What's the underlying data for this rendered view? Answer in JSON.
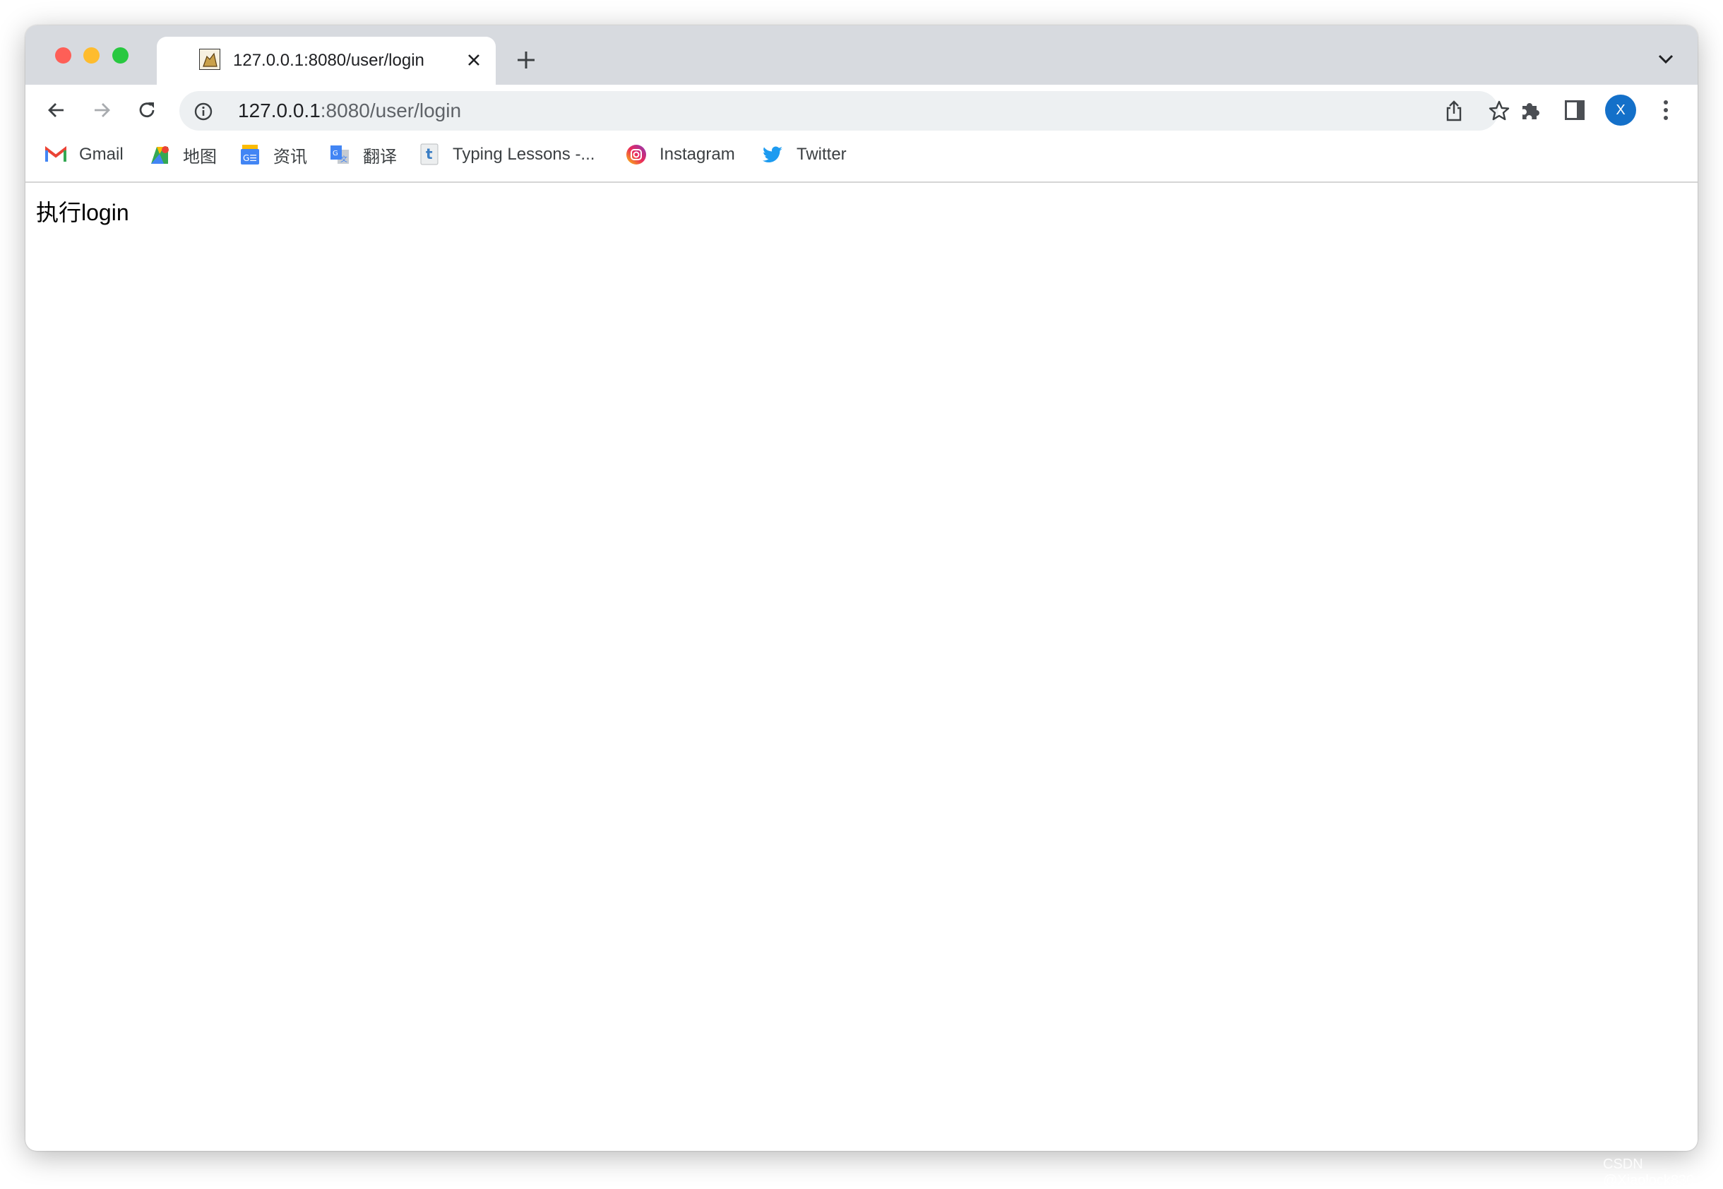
{
  "window": {
    "traffic_lights": {
      "close": "#fe5f57",
      "minimize": "#febc2e",
      "maximize": "#28c840"
    }
  },
  "tab": {
    "title": "127.0.0.1:8080/user/login",
    "favicon": "tomcat-icon"
  },
  "toolbar": {
    "url_host": "127.0.0.1",
    "url_rest": ":8080/user/login",
    "avatar_letter": "X",
    "avatar_color": "#1a73e8"
  },
  "bookmarks": [
    {
      "label": "Gmail",
      "icon": "gmail-icon"
    },
    {
      "label": "地图",
      "icon": "maps-icon"
    },
    {
      "label": "资讯",
      "icon": "news-icon"
    },
    {
      "label": "翻译",
      "icon": "translate-icon"
    },
    {
      "label": "Typing Lessons -...",
      "icon": "typing-icon"
    },
    {
      "label": "Instagram",
      "icon": "instagram-icon"
    },
    {
      "label": "Twitter",
      "icon": "twitter-icon"
    }
  ],
  "page": {
    "body_text": "执行login"
  },
  "watermark": "CSDN @Xiaolock830"
}
